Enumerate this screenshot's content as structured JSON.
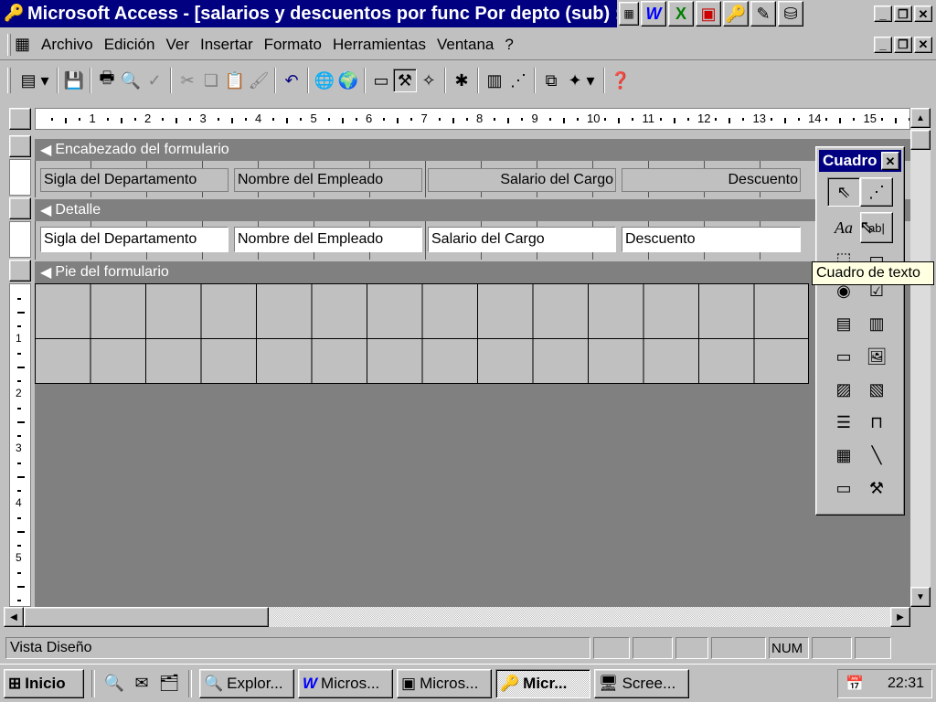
{
  "window": {
    "title": "Microsoft Access - [salarios y descuentos por func Por depto (sub) : Fo",
    "tray_apps": [
      "office-bar-icon",
      "word-icon",
      "excel-icon",
      "powerpoint-icon",
      "access-icon",
      "notepad-icon",
      "installer-icon"
    ]
  },
  "menu": {
    "items": [
      {
        "label": "Archivo"
      },
      {
        "label": "Edición"
      },
      {
        "label": "Ver"
      },
      {
        "label": "Insertar"
      },
      {
        "label": "Formato"
      },
      {
        "label": "Herramientas"
      },
      {
        "label": "Ventana"
      },
      {
        "label": "?"
      }
    ]
  },
  "ruler": {
    "marks": [
      "1",
      "2",
      "3",
      "4",
      "5",
      "6",
      "7",
      "8",
      "9",
      "10",
      "11",
      "12",
      "13",
      "14",
      "15"
    ]
  },
  "form": {
    "header_band": "Encabezado del formulario",
    "detail_band": "Detalle",
    "footer_band": "Pie del formulario",
    "header_labels": [
      "Sigla del Departamento",
      "Nombre del Empleado",
      "Salario del Cargo",
      "Descuento"
    ],
    "detail_fields": [
      "Sigla del Departamento",
      "Nombre del Empleado",
      "Salario del Cargo",
      "Descuento"
    ]
  },
  "left_ruler": [
    "1",
    "2",
    "3",
    "4",
    "5"
  ],
  "toolbox": {
    "title": "Cuadro",
    "tooltip": "Cuadro de texto"
  },
  "status": {
    "text": "Vista Diseño",
    "num": "NUM"
  },
  "taskbar": {
    "start": "Inicio",
    "tasks": [
      {
        "label": "Explor..."
      },
      {
        "label": "Micros..."
      },
      {
        "label": "Micros..."
      },
      {
        "label": "Micr..."
      },
      {
        "label": "Scree..."
      }
    ],
    "clock": "22:31"
  },
  "colors": {
    "titlebar": "#000080",
    "face": "#c0c0c0",
    "workspace": "#808080"
  }
}
